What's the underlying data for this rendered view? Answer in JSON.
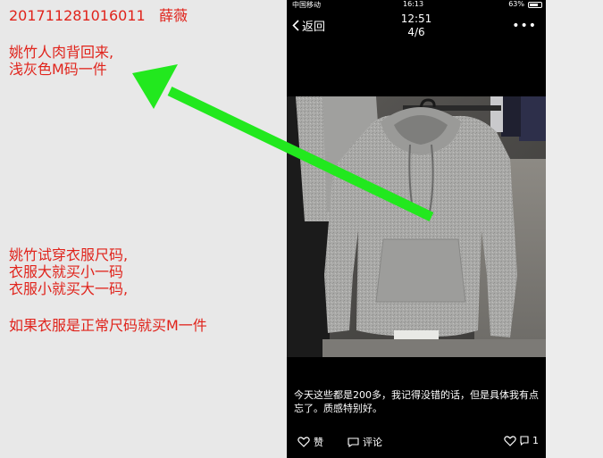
{
  "notes": {
    "id": "201711281016011",
    "name": "薛薇",
    "line1": "姚竹人肉背回来,",
    "line2": "浅灰色M码一件",
    "size_line1": "姚竹试穿衣服尺码,",
    "size_line2": "衣服大就买小一码",
    "size_line3": "衣服小就买大一码,",
    "size_line4": "如果衣服是正常尺码就买M一件"
  },
  "status_bar": {
    "carrier": "中国移动",
    "time": "16:13",
    "battery": "63%"
  },
  "nav": {
    "back_label": "返回",
    "time": "12:51",
    "page": "4/6",
    "more_label": "•••"
  },
  "photo": {
    "subject": "light gray hoodie on hanger"
  },
  "caption": {
    "text": "今天这些都是200多，我记得没错的话，但是具体我有点忘了。质感特别好。"
  },
  "actions": {
    "like_label": "赞",
    "comment_label": "评论",
    "like_count": "1"
  },
  "colors": {
    "annotation_red": "#e0231b",
    "arrow_green": "#22e81e",
    "phone_bg": "#000000"
  }
}
